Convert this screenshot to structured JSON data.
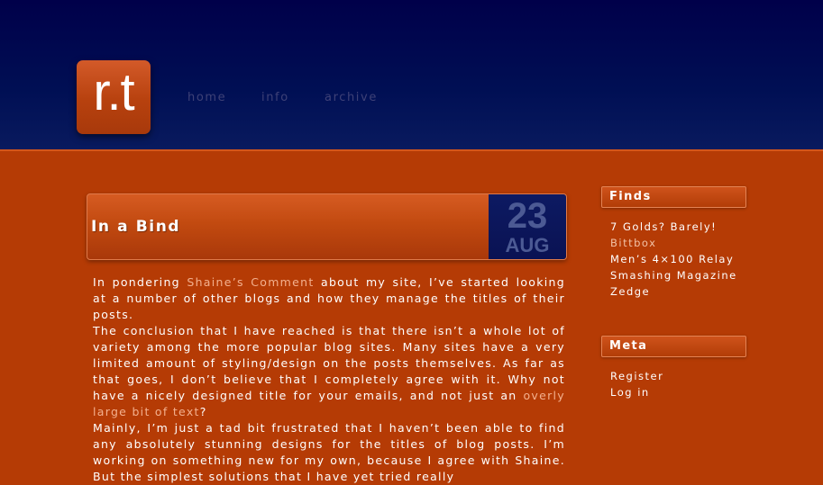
{
  "site": {
    "logo_text": "r.t"
  },
  "nav": [
    {
      "label": "home"
    },
    {
      "label": "info"
    },
    {
      "label": "archive"
    }
  ],
  "post": {
    "title": "In a Bind",
    "date": {
      "day": "23",
      "month": "AUG"
    },
    "paragraphs": [
      {
        "before": "In pondering ",
        "link": "Shaine’s Comment",
        "after": " about my site, I’ve started looking at a number of other blogs and how they manage the titles of their posts."
      },
      {
        "before": "The conclusion that I have reached is that there isn’t a whole lot of variety among the more popular blog sites. Many sites have a very limited amount of styling/design on the posts themselves. As far as that goes, I don’t believe that I completely agree with it. Why not have a nicely designed title for your emails, and not just an ",
        "link": "overly large bit of text",
        "after": "?"
      },
      {
        "before": "Mainly, I’m just a tad bit frustrated that I haven’t been able to find any absolutely stunning designs for the titles of blog posts. I’m working on something new for my own, because I agree with Shaine. But the simplest solutions that I have yet tried really",
        "link": "",
        "after": ""
      }
    ]
  },
  "sidebar": {
    "finds": {
      "title": "Finds",
      "items": [
        {
          "label": "7 Golds? Barely!"
        },
        {
          "label": "Bittbox"
        },
        {
          "label": "Men’s 4×100 Relay"
        },
        {
          "label": "Smashing Magazine"
        },
        {
          "label": "Zedge"
        }
      ]
    },
    "meta": {
      "title": "Meta",
      "items": [
        {
          "label": "Register"
        },
        {
          "label": "Log in"
        }
      ]
    }
  },
  "colors": {
    "header_navy": "#00004a",
    "page_orange": "#b53b05",
    "nav_text": "#3e4177",
    "link_peach": "#f3b08e"
  }
}
